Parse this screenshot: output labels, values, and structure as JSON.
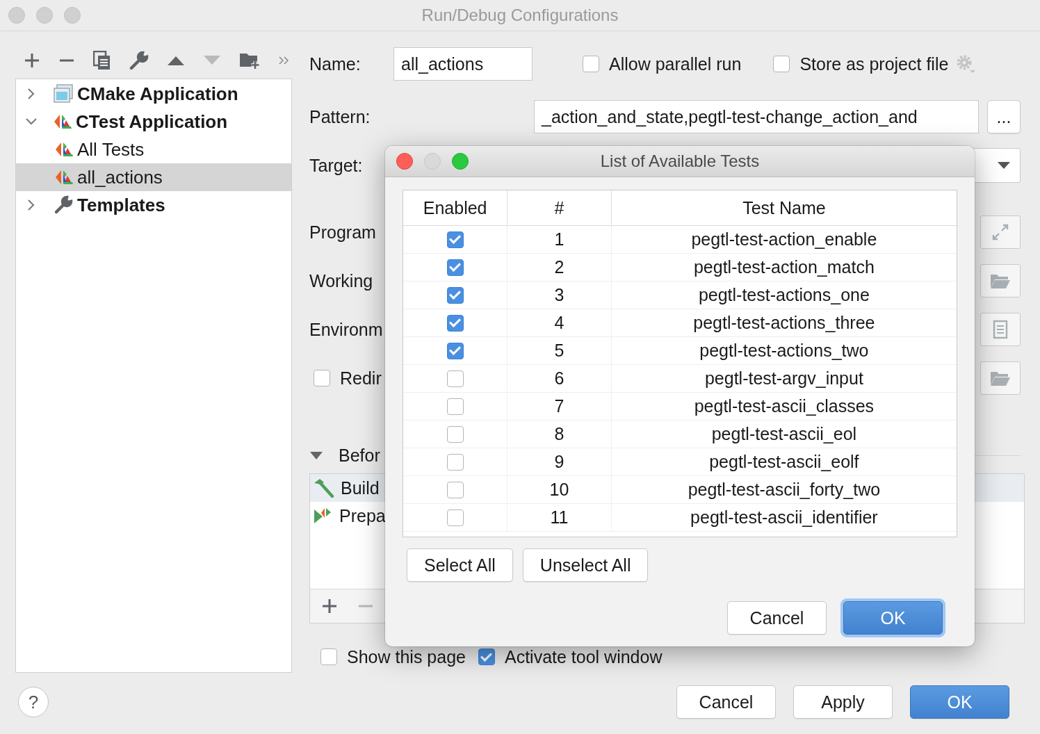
{
  "window": {
    "title": "Run/Debug Configurations"
  },
  "toolbar": [
    {
      "kind": "add",
      "disabled": false
    },
    {
      "kind": "remove",
      "disabled": false
    },
    {
      "kind": "copy",
      "disabled": false
    },
    {
      "kind": "wrench",
      "disabled": false
    },
    {
      "kind": "up",
      "disabled": false
    },
    {
      "kind": "down",
      "disabled": true
    },
    {
      "kind": "folder-add",
      "disabled": false
    },
    {
      "kind": "more",
      "disabled": false
    }
  ],
  "tree": [
    {
      "label": "CMake Application",
      "kind": "cmake",
      "expanded": false,
      "selected": false
    },
    {
      "label": "CTest Application",
      "kind": "ctest",
      "expanded": true,
      "selected": false,
      "children": [
        {
          "label": "All Tests",
          "kind": "ctest",
          "selected": false
        },
        {
          "label": "all_actions",
          "kind": "ctest",
          "selected": true
        }
      ]
    },
    {
      "label": "Templates",
      "kind": "wrench",
      "expanded": false,
      "selected": false
    }
  ],
  "form": {
    "name_label": "Name:",
    "name_value": "all_actions",
    "parallel": {
      "label": "Allow parallel run",
      "checked": false
    },
    "store": {
      "label": "Store as project file",
      "checked": false
    },
    "pattern_label": "Pattern:",
    "pattern_value": "_action_and_state,pegtl-test-change_action_and",
    "pattern_button": "...",
    "target_label": "Target:",
    "fields": [
      {
        "label": "Program",
        "kind": "expand"
      },
      {
        "label": "Working",
        "kind": "folder"
      },
      {
        "label": "Environm",
        "kind": "document"
      }
    ],
    "redirect": {
      "label": "Redir",
      "checked": false
    }
  },
  "before_launch": {
    "label": "Befor",
    "expanded": true,
    "tasks": [
      {
        "label": "Build",
        "kind": "build",
        "selected": true
      },
      {
        "label": "Prepa",
        "kind": "prepare",
        "selected": false
      }
    ],
    "tools": [
      {
        "kind": "add",
        "disabled": false
      },
      {
        "kind": "remove",
        "disabled": true
      }
    ]
  },
  "show_page": {
    "label": "Show this page",
    "checked": false
  },
  "activate": {
    "label": "Activate tool window",
    "checked": true
  },
  "help_button": "?",
  "footer_buttons": [
    {
      "label": "Cancel",
      "default": false
    },
    {
      "label": "Apply",
      "default": false
    },
    {
      "label": "OK",
      "default": true
    }
  ],
  "dialog": {
    "title": "List of Available Tests",
    "columns": [
      "Enabled",
      "#",
      "Test Name"
    ],
    "rows": [
      {
        "enabled": true,
        "number": "1",
        "name": "pegtl-test-action_enable"
      },
      {
        "enabled": true,
        "number": "2",
        "name": "pegtl-test-action_match"
      },
      {
        "enabled": true,
        "number": "3",
        "name": "pegtl-test-actions_one"
      },
      {
        "enabled": true,
        "number": "4",
        "name": "pegtl-test-actions_three"
      },
      {
        "enabled": true,
        "number": "5",
        "name": "pegtl-test-actions_two"
      },
      {
        "enabled": false,
        "number": "6",
        "name": "pegtl-test-argv_input"
      },
      {
        "enabled": false,
        "number": "7",
        "name": "pegtl-test-ascii_classes"
      },
      {
        "enabled": false,
        "number": "8",
        "name": "pegtl-test-ascii_eol"
      },
      {
        "enabled": false,
        "number": "9",
        "name": "pegtl-test-ascii_eolf"
      },
      {
        "enabled": false,
        "number": "10",
        "name": "pegtl-test-ascii_forty_two"
      },
      {
        "enabled": false,
        "number": "11",
        "name": "pegtl-test-ascii_identifier"
      }
    ],
    "list_buttons": [
      "Select All",
      "Unselect All"
    ],
    "actions": [
      {
        "label": "Cancel",
        "default": false
      },
      {
        "label": "OK",
        "default": true
      }
    ]
  }
}
